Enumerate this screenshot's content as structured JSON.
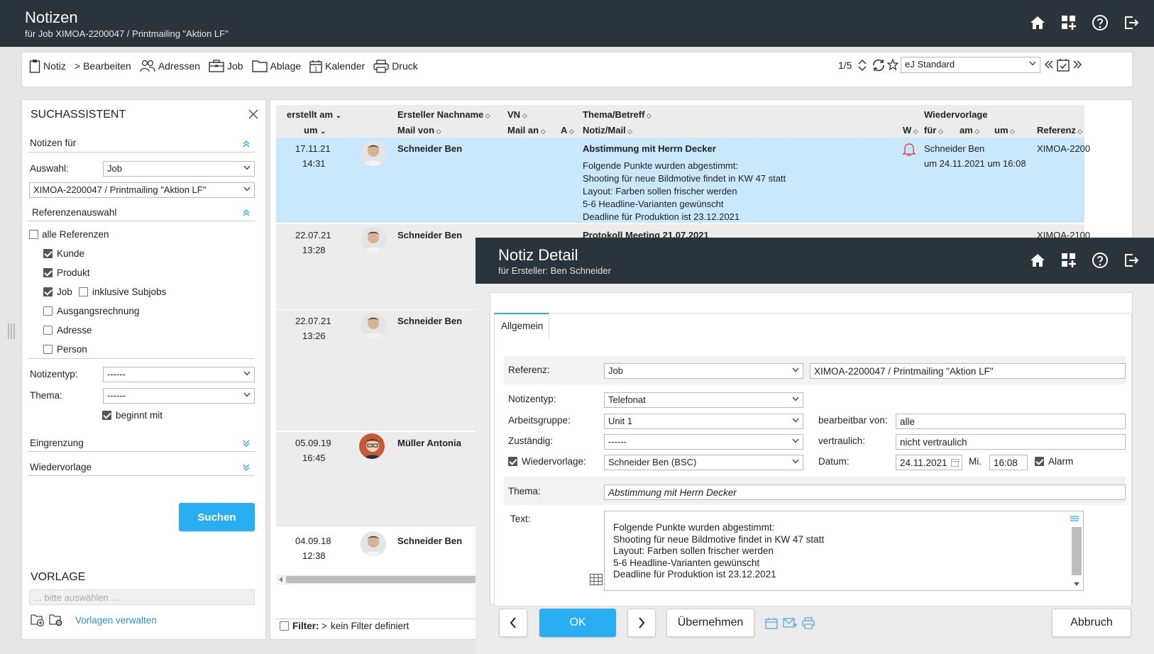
{
  "header": {
    "title": "Notizen",
    "subtitle": "für Job XIMOA-2200047 / Printmailing \"Aktion LF\""
  },
  "toolbar": {
    "items": [
      "Notiz",
      "Bearbeiten",
      "Adressen",
      "Job",
      "Ablage",
      "Kalender",
      "Druck"
    ],
    "pager": "1/5",
    "view": "eJ Standard"
  },
  "search": {
    "title": "SUCHASSISTENT",
    "notes_for": "Notizen für",
    "selection_label": "Auswahl:",
    "selection_value": "Job",
    "job_value": "XIMOA-2200047 / Printmailing \"Aktion LF\"",
    "refsel": "Referenzenauswahl",
    "all_refs": "alle Referenzen",
    "refs": [
      "Kunde",
      "Produkt",
      "Job",
      "inklusive Subjobs",
      "Ausgangsrechnung",
      "Adresse",
      "Person"
    ],
    "notetype_label": "Notizentyp:",
    "notetype_value": "------",
    "topic_label": "Thema:",
    "topic_value": "------",
    "starts_with": "beginnt mit",
    "limit": "Eingrenzung",
    "resubmission": "Wiedervorlage",
    "search_btn": "Suchen",
    "template_title": "VORLAGE",
    "template_placeholder": "... bitte auswählen ...",
    "manage_templates": "Vorlagen verwalten"
  },
  "grid": {
    "headers1": [
      "erstellt am",
      "Ersteller Nachname",
      "VN",
      "Thema/Betreff",
      "Wiedervorlage"
    ],
    "headers2": [
      "um",
      "Mail von",
      "Mail an",
      "A",
      "Notiz/Mail",
      "W",
      "für",
      "am",
      "um",
      "Referenz"
    ],
    "rows": [
      {
        "date": "17.11.21",
        "time": "14:31",
        "name": "Schneider Ben",
        "subject": "Abstimmung mit Herrn Decker",
        "body": [
          "Folgende Punkte wurden abgestimmt:",
          "Shooting für neue Bildmotive findet in KW 47 statt",
          "Layout: Farben sollen frischer werden",
          "5-6 Headline-Varianten gewünscht",
          "Deadline für Produktion ist 23.12.2021"
        ],
        "wv_person": "Schneider Ben",
        "wv_date": "um 24.11.2021 um 16:08",
        "ref": "XIMOA-2200"
      },
      {
        "date": "22.07.21",
        "time": "13:28",
        "name": "Schneider Ben",
        "subject": "Protokoll Meeting 21.07.2021",
        "ref": "XIMOA-2100"
      },
      {
        "date": "22.07.21",
        "time": "13:26",
        "name": "Schneider Ben"
      },
      {
        "date": "05.09.19",
        "time": "16:45",
        "name": "Müller Antonia"
      },
      {
        "date": "04.09.18",
        "time": "12:38",
        "name": "Schneider Ben"
      }
    ],
    "filter_label": "Filter:",
    "filter_value": "kein Filter definiert"
  },
  "detail": {
    "title": "Notiz Detail",
    "subtitle": "für Ersteller: Ben Schneider",
    "tab": "Allgemein",
    "ref_label": "Referenz:",
    "ref_type": "Job",
    "ref_value": "XIMOA-2200047 / Printmailing \"Aktion LF\"",
    "notetype_label": "Notizentyp:",
    "notetype_value": "Telefonat",
    "workgroup_label": "Arbeitsgruppe:",
    "workgroup_value": "Unit 1",
    "editable_label": "bearbeitbar von:",
    "editable_value": "alle",
    "responsible_label": "Zuständig:",
    "responsible_value": "------",
    "confidential_label": "vertraulich:",
    "confidential_value": "nicht vertraulich",
    "resub_label": "Wiedervorlage:",
    "resub_value": "Schneider Ben (BSC)",
    "date_label": "Datum:",
    "date_value": "24.11.2021",
    "weekday": "Mi.",
    "time_value": "16:08",
    "alarm_label": "Alarm",
    "topic_label": "Thema:",
    "topic_value": "Abstimmung mit Herrn Decker",
    "text_label": "Text:",
    "text_lines": [
      "Folgende Punkte wurden abgestimmt:",
      "Shooting für neue Bildmotive findet in KW 47 statt",
      "Layout: Farben sollen frischer werden",
      "5-6  Headline-Varianten gewünscht",
      "Deadline für Produktion ist 23.12.2021"
    ],
    "btn_ok": "OK",
    "btn_apply": "Übernehmen",
    "btn_cancel": "Abbruch"
  },
  "colors": {
    "header": "#2b333b",
    "accent": "#2aaef2",
    "selected_row": "#c9e8fb"
  }
}
